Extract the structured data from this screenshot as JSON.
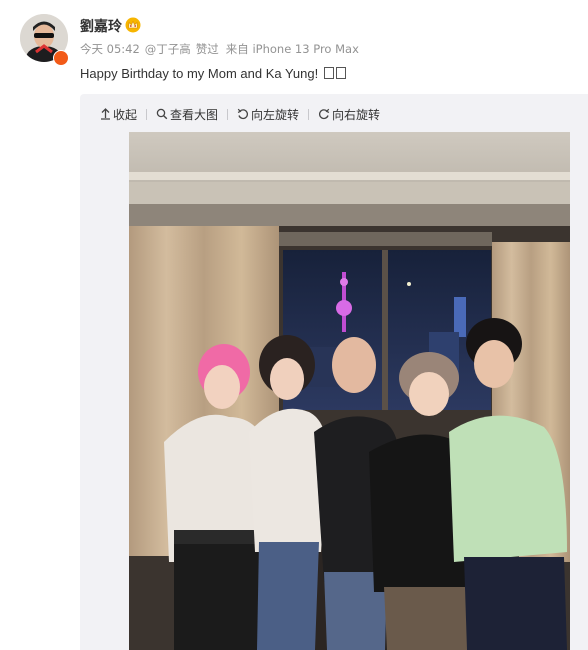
{
  "post": {
    "author": "劉嘉玲",
    "meta": {
      "time": "今天 05:42",
      "mention": "@丁子高",
      "liked": "赞过",
      "via": "来自 iPhone 13 Pro Max"
    },
    "text": "Happy Birthday to my Mom and Ka Yung! "
  },
  "toolbar": {
    "collapse": "收起",
    "view_large": "查看大图",
    "rotate_left": "向左旋转",
    "rotate_right": "向右旋转"
  },
  "icons": {
    "verified": "orange-verified-badge",
    "crown": "gold-crown-icon",
    "collapse": "arrow-up-icon",
    "view_large": "magnifier-icon",
    "rotate_left": "rotate-left-icon",
    "rotate_right": "rotate-right-icon"
  },
  "colors": {
    "meta_text": "#939393",
    "panel_bg": "#f2f2f5",
    "verified_badge": "#f25a18",
    "crown": "#f0a100"
  }
}
